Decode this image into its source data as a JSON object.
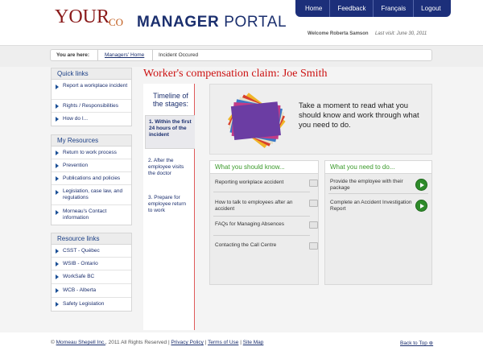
{
  "header": {
    "logo_main": "YOUR",
    "logo_co": "CO",
    "portal_bold": "MANAGER",
    "portal_light": "PORTAL",
    "nav": [
      "Home",
      "Feedback",
      "Français",
      "Logout"
    ],
    "welcome": "Welcome Roberta Samson",
    "last_visit": "Last visit: June 30, 2011"
  },
  "breadcrumb": {
    "prefix": "You are here:",
    "home": "Managers' Home",
    "current": "Incident Occured"
  },
  "sidebar": {
    "quick_links": {
      "title": "Quick links",
      "items": [
        "Report a workplace incident",
        "Rights / Responsibilities",
        "How do I..."
      ]
    },
    "my_resources": {
      "title": "My Resources",
      "items": [
        "Return to work process",
        "Prevention",
        "Publications and policies",
        "Legislation, case law, and regulations",
        "Morneau's Contact information"
      ]
    },
    "resource_links": {
      "title": "Resource links",
      "items": [
        "CSST - Québec",
        "WSIB - Ontario",
        "WorkSafe BC",
        "WCB - Alberta",
        "Safety Legislation"
      ]
    }
  },
  "main": {
    "title": "Worker's compensation claim: Joe Smith",
    "timeline": {
      "heading": "Timeline of the stages:",
      "stages": [
        "1. Within the first 24 hours of the incident",
        "2. After the employee visits the doctor",
        "3. Prepare for employee return to work"
      ]
    },
    "hero_text": "Take a moment to read what you should know and work through what you need to do.",
    "know_panel": {
      "title": "What you should know...",
      "items": [
        "Reporting workplace accident",
        "How to talk to employees after an accident",
        "FAQs for Managing Absences",
        "Contacting the Call Centre"
      ]
    },
    "need_panel": {
      "title": "What you need to do...",
      "items": [
        "Provide the employee with their package",
        "Complete an Accident Investigation Report"
      ]
    }
  },
  "footer": {
    "copyright": "© ",
    "company": "Morneau Shepell Inc.",
    "rights": ", 2011  All Rights Reserved | ",
    "privacy": "Privacy Policy",
    "sep1": " | ",
    "terms": "Terms of Use",
    "sep2": " | ",
    "sitemap": "Site Map",
    "back_to_top": "Back to Top",
    "back_to_top_glyph": "⊕"
  }
}
